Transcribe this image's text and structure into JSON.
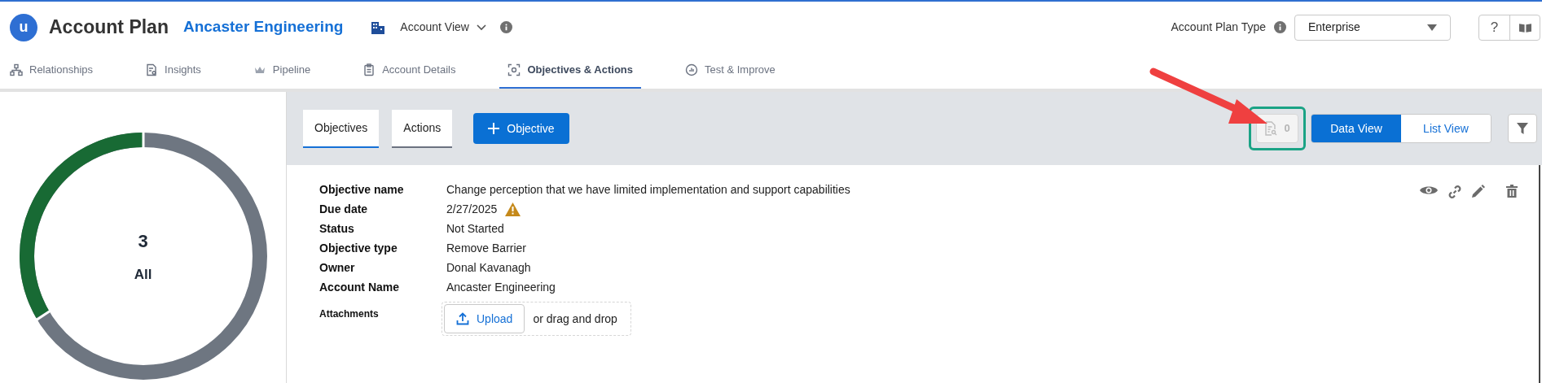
{
  "header": {
    "logo": "u",
    "title": "Account Plan",
    "account": "Ancaster Engineering",
    "view": "Account View",
    "plan_type_label": "Account Plan Type",
    "plan_type": "Enterprise",
    "help": "?"
  },
  "nav_tabs": [
    {
      "label": "Relationships",
      "selected": false
    },
    {
      "label": "Insights",
      "selected": false
    },
    {
      "label": "Pipeline",
      "selected": false
    },
    {
      "label": "Account Details",
      "selected": false
    },
    {
      "label": "Objectives & Actions",
      "selected": true
    },
    {
      "label": "Test & Improve",
      "selected": false
    }
  ],
  "summary": {
    "count": "3",
    "label": "All"
  },
  "toolbar": {
    "tabs": [
      {
        "label": "Objectives",
        "selected": true
      },
      {
        "label": "Actions",
        "selected": false
      }
    ],
    "add_button": "Objective",
    "doc_count": "0",
    "views": [
      {
        "label": "Data View",
        "selected": true
      },
      {
        "label": "List View",
        "selected": false
      }
    ]
  },
  "objective": {
    "fields": [
      {
        "label": "Objective name",
        "value": "Change perception that we have limited implementation and support capabilities",
        "warning": false
      },
      {
        "label": "Due date",
        "value": "2/27/2025",
        "warning": true
      },
      {
        "label": "Status",
        "value": "Not Started",
        "warning": false
      },
      {
        "label": "Objective type",
        "value": "Remove Barrier",
        "warning": false
      },
      {
        "label": "Owner",
        "value": "Donal Kavanagh",
        "warning": false
      },
      {
        "label": "Account Name",
        "value": "Ancaster Engineering",
        "warning": false
      }
    ],
    "attachments_label": "Attachments",
    "upload_button": "Upload",
    "drop_hint": "or drag and drop"
  }
}
